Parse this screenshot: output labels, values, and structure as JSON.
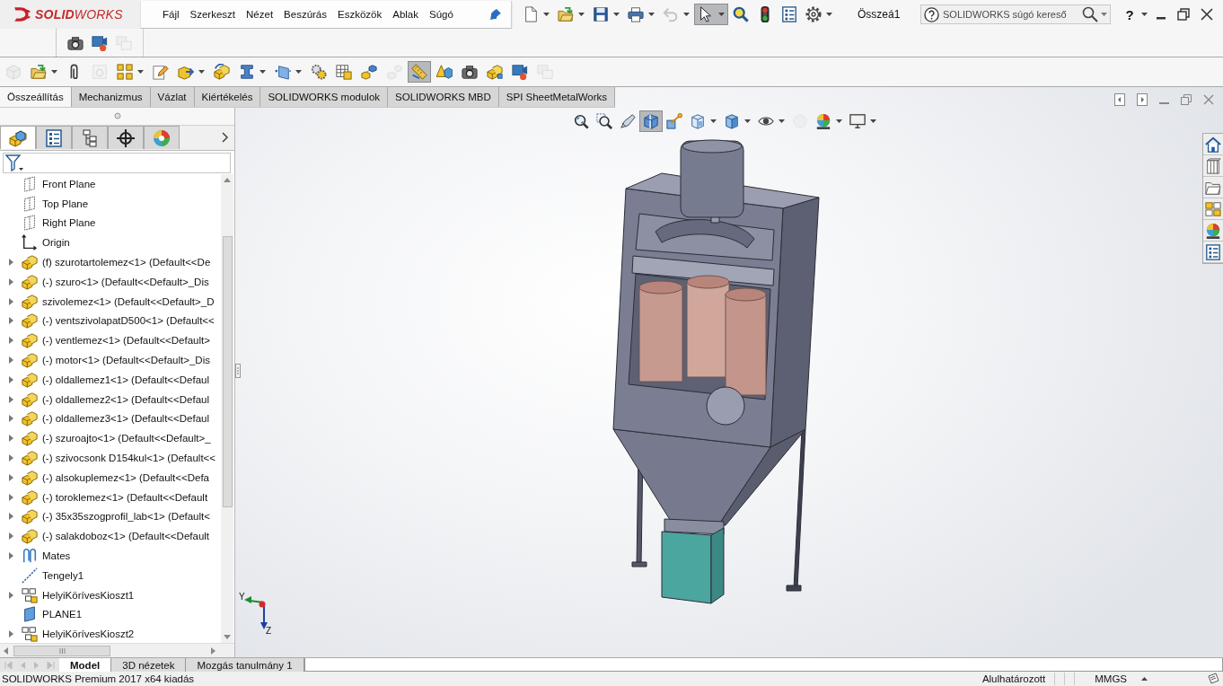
{
  "app": {
    "logo": "**SOLID**WORKS"
  },
  "menu": [
    "Fájl",
    "Szerkeszt",
    "Nézet",
    "Beszúrás",
    "Eszközök",
    "Ablak",
    "Súgó"
  ],
  "quick_toolbar": [
    {
      "kind": "new",
      "dropdown": true,
      "pressed": false,
      "disabled": false
    },
    {
      "kind": "open",
      "dropdown": true,
      "pressed": false,
      "disabled": false
    },
    {
      "kind": "save",
      "dropdown": true,
      "pressed": false,
      "disabled": false
    },
    {
      "kind": "print",
      "dropdown": true,
      "pressed": false,
      "disabled": false
    },
    {
      "kind": "undo",
      "dropdown": true,
      "pressed": false,
      "disabled": true
    },
    {
      "kind": "select",
      "dropdown": true,
      "pressed": true,
      "disabled": false
    },
    {
      "kind": "inspect",
      "dropdown": false,
      "pressed": false,
      "disabled": false
    },
    {
      "kind": "rebuild",
      "dropdown": false,
      "pressed": false,
      "disabled": false
    },
    {
      "kind": "properties",
      "dropdown": false,
      "pressed": false,
      "disabled": false
    },
    {
      "kind": "options",
      "dropdown": true,
      "pressed": false,
      "disabled": false
    }
  ],
  "document_title": "Összeá1",
  "search": {
    "placeholder": "SOLIDWORKS súgó kereső"
  },
  "help": {
    "label": "?"
  },
  "second_toolbar": [
    {
      "kind": "camera",
      "disabled": false
    },
    {
      "kind": "record",
      "disabled": false
    },
    {
      "kind": "screens",
      "disabled": true
    }
  ],
  "command_toolbar": [
    {
      "kind": "insert",
      "dropdown": false,
      "pressed": false,
      "disabled": true
    },
    {
      "kind": "open",
      "dropdown": true,
      "pressed": false,
      "disabled": false
    },
    {
      "kind": "mate",
      "dropdown": false,
      "pressed": false,
      "disabled": false
    },
    {
      "kind": "preview",
      "dropdown": false,
      "pressed": false,
      "disabled": true
    },
    {
      "kind": "pattern",
      "dropdown": true,
      "pressed": false,
      "disabled": false
    },
    {
      "kind": "edit",
      "dropdown": false,
      "pressed": false,
      "disabled": false
    },
    {
      "kind": "move",
      "dropdown": true,
      "pressed": false,
      "disabled": false
    },
    {
      "kind": "rotate",
      "dropdown": false,
      "pressed": false,
      "disabled": false
    },
    {
      "kind": "fastener",
      "dropdown": true,
      "pressed": false,
      "disabled": false
    },
    {
      "kind": "plane",
      "dropdown": true,
      "pressed": false,
      "disabled": false
    },
    {
      "kind": "motion",
      "dropdown": false,
      "pressed": false,
      "disabled": false
    },
    {
      "kind": "table",
      "dropdown": false,
      "pressed": false,
      "disabled": false
    },
    {
      "kind": "explode",
      "dropdown": false,
      "pressed": false,
      "disabled": false
    },
    {
      "kind": "sketch",
      "dropdown": false,
      "pressed": false,
      "disabled": true
    },
    {
      "kind": "ruler",
      "dropdown": false,
      "pressed": true,
      "disabled": false
    },
    {
      "kind": "interference",
      "dropdown": false,
      "pressed": false,
      "disabled": false
    },
    {
      "kind": "camera",
      "dropdown": false,
      "pressed": false,
      "disabled": false
    },
    {
      "kind": "blocks",
      "dropdown": false,
      "pressed": false,
      "disabled": false
    },
    {
      "kind": "record",
      "dropdown": false,
      "pressed": false,
      "disabled": false
    },
    {
      "kind": "screens",
      "dropdown": false,
      "pressed": false,
      "disabled": true
    }
  ],
  "command_tabs": [
    {
      "label": "Összeállítás",
      "selected": true
    },
    {
      "label": "Mechanizmus",
      "selected": false
    },
    {
      "label": "Vázlat",
      "selected": false
    },
    {
      "label": "Kiértékelés",
      "selected": false
    },
    {
      "label": "SOLIDWORKS modulok",
      "selected": false
    },
    {
      "label": "SOLIDWORKS MBD",
      "selected": false
    },
    {
      "label": "SPI SheetMetalWorks",
      "selected": false
    }
  ],
  "feature_manager": {
    "tabs": [
      {
        "kind": "tree",
        "selected": true
      },
      {
        "kind": "properties",
        "selected": false
      },
      {
        "kind": "config",
        "selected": false
      },
      {
        "kind": "dimxpert",
        "selected": false
      },
      {
        "kind": "colors",
        "selected": false
      }
    ],
    "tree": [
      {
        "label": "Front Plane",
        "kind": "refplane",
        "expandable": false
      },
      {
        "label": "Top Plane",
        "kind": "refplane",
        "expandable": false
      },
      {
        "label": "Right Plane",
        "kind": "refplane",
        "expandable": false
      },
      {
        "label": "Origin",
        "kind": "origin",
        "expandable": false
      },
      {
        "label": "(f) szurotartolemez<1> (Default<<De",
        "kind": "part",
        "expandable": true
      },
      {
        "label": "(-) szuro<1> (Default<<Default>_Dis",
        "kind": "part",
        "expandable": true
      },
      {
        "label": "szivolemez<1> (Default<<Default>_D",
        "kind": "part",
        "expandable": true
      },
      {
        "label": "(-) ventszivolapatD500<1> (Default<<",
        "kind": "part",
        "expandable": true
      },
      {
        "label": "(-) ventlemez<1> (Default<<Default>",
        "kind": "part",
        "expandable": true
      },
      {
        "label": "(-) motor<1> (Default<<Default>_Dis",
        "kind": "part",
        "expandable": true
      },
      {
        "label": "(-) oldallemez1<1> (Default<<Defaul",
        "kind": "part",
        "expandable": true
      },
      {
        "label": "(-) oldallemez2<1> (Default<<Defaul",
        "kind": "part",
        "expandable": true
      },
      {
        "label": "(-) oldallemez3<1> (Default<<Defaul",
        "kind": "part",
        "expandable": true
      },
      {
        "label": "(-) szuroajto<1> (Default<<Default>_",
        "kind": "part",
        "expandable": true
      },
      {
        "label": "(-) szivocsonk D154kul<1> (Default<<",
        "kind": "part",
        "expandable": true
      },
      {
        "label": "(-) alsokuplemez<1> (Default<<Defa",
        "kind": "part",
        "expandable": true
      },
      {
        "label": "(-) toroklemez<1> (Default<<Default",
        "kind": "part",
        "expandable": true
      },
      {
        "label": "(-) 35x35szogprofil_lab<1> (Default<",
        "kind": "part",
        "expandable": true
      },
      {
        "label": "(-) salakdoboz<1> (Default<<Default",
        "kind": "part",
        "expandable": true
      },
      {
        "label": "Mates",
        "kind": "mates",
        "expandable": true
      },
      {
        "label": "Tengely1",
        "kind": "axis",
        "expandable": false
      },
      {
        "label": "HelyiKörívesKioszt1",
        "kind": "circpattern",
        "expandable": true
      },
      {
        "label": "PLANE1",
        "kind": "surface",
        "expandable": false
      },
      {
        "label": "HelyiKörívesKioszt2",
        "kind": "circpattern",
        "expandable": true
      }
    ]
  },
  "viewport": {
    "heads_up_toolbar": [
      {
        "kind": "zoomfit",
        "dropdown": false,
        "pressed": false,
        "disabled": false
      },
      {
        "kind": "zoomarea",
        "dropdown": false,
        "pressed": false,
        "disabled": false
      },
      {
        "kind": "previous",
        "dropdown": false,
        "pressed": false,
        "disabled": false
      },
      {
        "kind": "section",
        "dropdown": false,
        "pressed": true,
        "disabled": false
      },
      {
        "kind": "annotate",
        "dropdown": false,
        "pressed": false,
        "disabled": false
      },
      {
        "kind": "orientation",
        "dropdown": true,
        "pressed": false,
        "disabled": false
      },
      {
        "kind": "display",
        "dropdown": true,
        "pressed": false,
        "disabled": false
      },
      {
        "kind": "hide",
        "dropdown": true,
        "pressed": false,
        "disabled": false
      },
      {
        "kind": "scene",
        "dropdown": false,
        "pressed": false,
        "disabled": true
      },
      {
        "kind": "appearance",
        "dropdown": true,
        "pressed": false,
        "disabled": false
      },
      {
        "kind": "monitor",
        "dropdown": true,
        "pressed": false,
        "disabled": false
      }
    ],
    "triad": {
      "labels": [
        "Y",
        "Z"
      ]
    }
  },
  "task_pane": [
    {
      "kind": "home"
    },
    {
      "kind": "parts"
    },
    {
      "kind": "folder"
    },
    {
      "kind": "palette"
    },
    {
      "kind": "appearance"
    },
    {
      "kind": "properties"
    }
  ],
  "bottom_tabs": [
    {
      "label": "Model",
      "selected": true
    },
    {
      "label": "3D nézetek",
      "selected": false
    },
    {
      "label": "Mozgás tanulmány 1",
      "selected": false
    }
  ],
  "status_bar": {
    "product": "SOLIDWORKS Premium 2017 x64 kiadás",
    "state": "Alulhatározott",
    "units": "MMGS"
  }
}
